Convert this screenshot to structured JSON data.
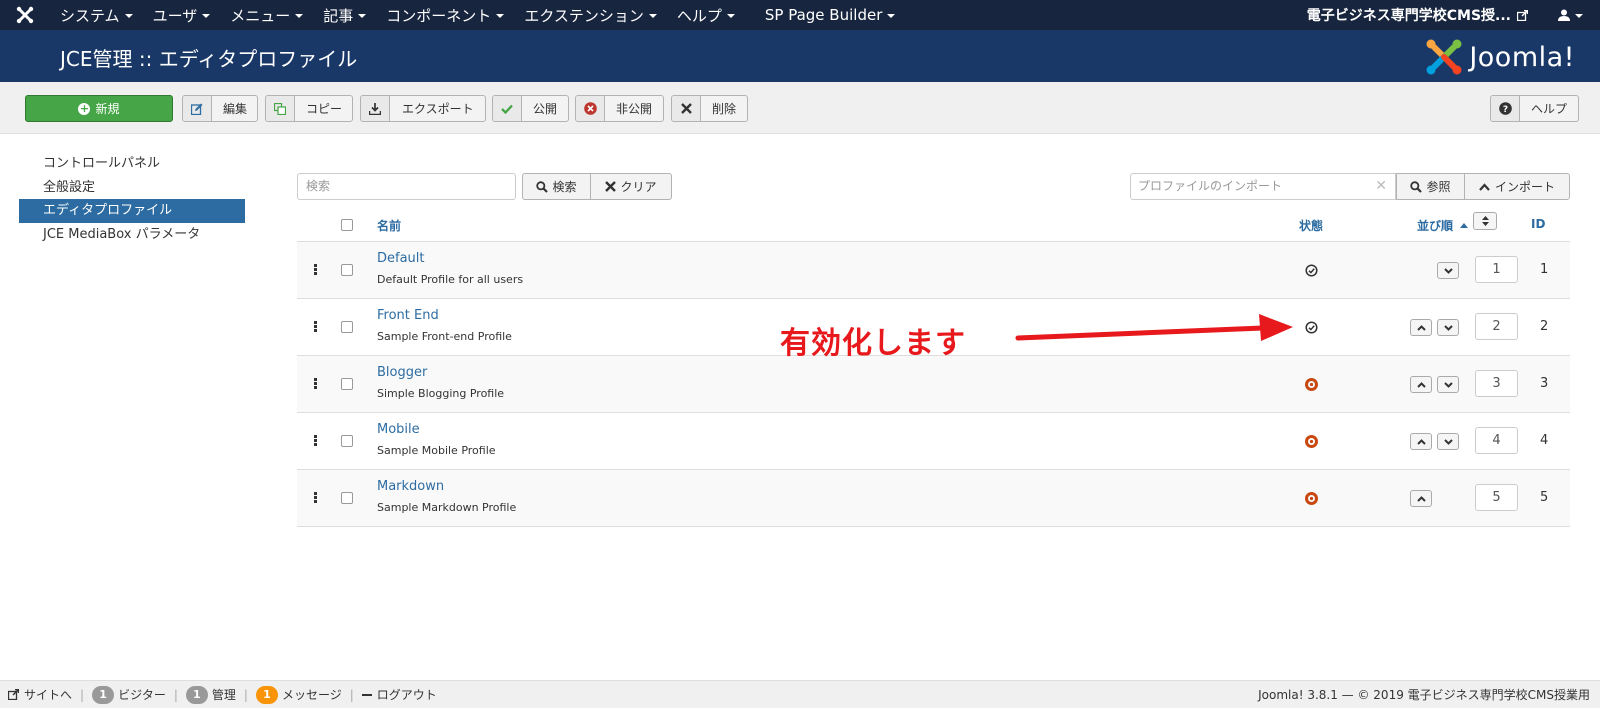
{
  "navbar": {
    "menus": [
      "システム",
      "ユーザ",
      "メニュー",
      "記事",
      "コンポーネント",
      "エクステンション",
      "ヘルプ",
      "SP Page Builder"
    ],
    "site_name": "電子ビジネス専門学校CMS授..."
  },
  "header": {
    "title": "JCE管理 :: エディタプロファイル",
    "logo_text": "Joomla!"
  },
  "toolbar": {
    "new": "新規",
    "edit": "編集",
    "copy": "コピー",
    "export": "エクスポート",
    "publish": "公開",
    "unpublish": "非公開",
    "delete": "削除",
    "help": "ヘルプ"
  },
  "sidebar": {
    "items": [
      {
        "label": "コントロールパネル",
        "active": false
      },
      {
        "label": "全般設定",
        "active": false
      },
      {
        "label": "エディタプロファイル",
        "active": true
      },
      {
        "label": "JCE MediaBox パラメータ",
        "active": false
      }
    ]
  },
  "filter": {
    "search_placeholder": "検索",
    "search_button": "検索",
    "clear_button": "クリア",
    "import_placeholder": "プロファイルのインポート",
    "browse_button": "参照",
    "import_button": "インポート"
  },
  "table": {
    "headers": {
      "name": "名前",
      "status": "状態",
      "ordering": "並び順",
      "id": "ID"
    },
    "rows": [
      {
        "name": "Default",
        "desc": "Default Profile for all users",
        "status": "published",
        "order": "1",
        "id": "1",
        "up": false,
        "down": true
      },
      {
        "name": "Front End",
        "desc": "Sample Front-end Profile",
        "status": "published",
        "order": "2",
        "id": "2",
        "up": true,
        "down": true
      },
      {
        "name": "Blogger",
        "desc": "Simple Blogging Profile",
        "status": "unpublished",
        "order": "3",
        "id": "3",
        "up": true,
        "down": true
      },
      {
        "name": "Mobile",
        "desc": "Sample Mobile Profile",
        "status": "unpublished",
        "order": "4",
        "id": "4",
        "up": true,
        "down": true
      },
      {
        "name": "Markdown",
        "desc": "Sample Markdown Profile",
        "status": "unpublished",
        "order": "5",
        "id": "5",
        "up": true,
        "down": false
      }
    ]
  },
  "annotation": {
    "text": "有効化します",
    "color": "#e8191c"
  },
  "footer": {
    "view_site": "サイトへ",
    "visitors_count": "1",
    "visitors": "ビジター",
    "admins_count": "1",
    "admins": "管理",
    "messages_count": "1",
    "messages": "メッセージ",
    "logout": "ログアウト",
    "copyright": "Joomla! 3.8.1 — © 2019 電子ビジネス専門学校CMS授業用"
  },
  "colors": {
    "navbar": "#17253e",
    "header": "#1a3867",
    "primary": "#2d6ca2",
    "success": "#46a546",
    "danger": "#bd362f",
    "unpublished": "#c9480f"
  }
}
